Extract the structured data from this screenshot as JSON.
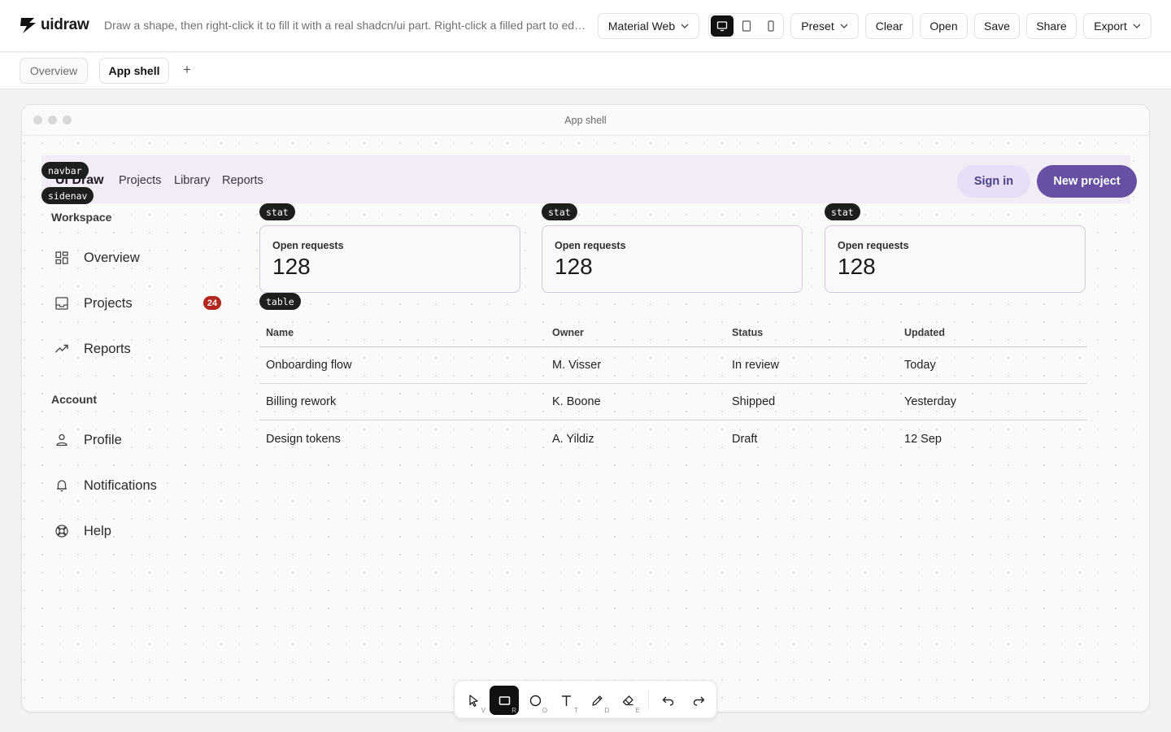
{
  "app": {
    "logo_text": "uidraw",
    "hint": "Draw a shape, then right-click it to fill it with a real shadcn/ui part. Right-click a filled part to edit..."
  },
  "toolbar": {
    "theme_select": "Material Web",
    "preset_label": "Preset",
    "clear_label": "Clear",
    "open_label": "Open",
    "save_label": "Save",
    "share_label": "Share",
    "export_label": "Export",
    "devices": [
      "desktop-icon",
      "tablet-icon",
      "phone-icon"
    ],
    "active_device": "desktop"
  },
  "page_tabs": [
    {
      "label": "Overview",
      "active": false
    },
    {
      "label": "App shell",
      "active": true
    }
  ],
  "add_tab_label": "+",
  "frame": {
    "title": "App shell",
    "navbar": {
      "brand": "UI Draw",
      "links": [
        "Projects",
        "Library",
        "Reports"
      ],
      "sign_in": "Sign in",
      "new_project": "New project",
      "surface_color": "#f2ecf6",
      "primary_color": "#6750a4"
    },
    "tags": {
      "navbar": "navbar",
      "sidenav": "sidenav",
      "stat": "stat",
      "table": "table"
    },
    "sidenav": {
      "sections": [
        {
          "title": "Workspace",
          "items": [
            {
              "label": "Overview",
              "icon": "dashboard-icon"
            },
            {
              "label": "Projects",
              "icon": "inbox-icon",
              "badge": "24"
            },
            {
              "label": "Reports",
              "icon": "trending-up-icon"
            }
          ]
        },
        {
          "title": "Account",
          "items": [
            {
              "label": "Profile",
              "icon": "person-icon"
            },
            {
              "label": "Notifications",
              "icon": "bell-icon"
            },
            {
              "label": "Help",
              "icon": "help-lifebuoy-icon"
            }
          ]
        }
      ]
    },
    "stats": [
      {
        "label": "Open requests",
        "value": "128"
      },
      {
        "label": "Open requests",
        "value": "128"
      },
      {
        "label": "Open requests",
        "value": "128"
      }
    ],
    "table": {
      "columns": [
        "Name",
        "Owner",
        "Status",
        "Updated"
      ],
      "rows": [
        [
          "Onboarding flow",
          "M. Visser",
          "In review",
          "Today"
        ],
        [
          "Billing rework",
          "K. Boone",
          "Shipped",
          "Yesterday"
        ],
        [
          "Design tokens",
          "A. Yildiz",
          "Draft",
          "12 Sep"
        ]
      ]
    }
  },
  "draw_tools": [
    {
      "name": "select-tool",
      "icon": "cursor-arrow-icon",
      "key": "V"
    },
    {
      "name": "rectangle-tool",
      "icon": "rectangle-icon",
      "key": "R",
      "active": true
    },
    {
      "name": "ellipse-tool",
      "icon": "circle-icon",
      "key": "O"
    },
    {
      "name": "text-tool",
      "icon": "text-t-icon",
      "key": "T"
    },
    {
      "name": "draw-tool",
      "icon": "pencil-icon",
      "key": "D"
    },
    {
      "name": "eraser-tool",
      "icon": "eraser-icon",
      "key": "E"
    }
  ],
  "history_tools": [
    {
      "name": "undo-button",
      "icon": "undo-icon"
    },
    {
      "name": "redo-button",
      "icon": "redo-icon"
    }
  ]
}
